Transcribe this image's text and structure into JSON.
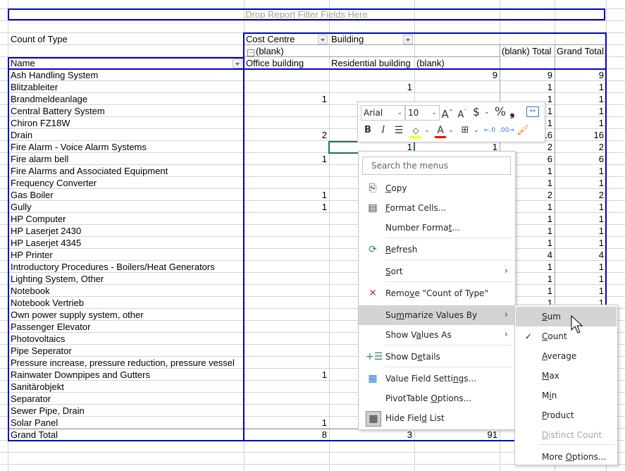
{
  "pivot": {
    "report_filter_placeholder": "Drop Report Filter Fields Here",
    "values_label": "Count of Type",
    "column_fields": [
      "Cost Centre",
      "Building"
    ],
    "col_group_label": "(blank)",
    "row_field": "Name",
    "column_headers": [
      "Office building",
      "Residential building",
      "(blank)",
      "(blank) Total",
      "Grand Total"
    ],
    "rows": [
      {
        "name": "Ash Handling System",
        "office": "",
        "residential": "",
        "blank": "9",
        "blank_total": "9",
        "grand_total": "9"
      },
      {
        "name": "Blitzableiter",
        "office": "",
        "residential": "1",
        "blank": "",
        "blank_total": "1",
        "grand_total": "1"
      },
      {
        "name": "Brandmeldeanlage",
        "office": "1",
        "residential": "",
        "blank": "",
        "blank_total": "1",
        "grand_total": "1"
      },
      {
        "name": "Central Battery System",
        "office": "",
        "residential": "",
        "blank": "",
        "blank_total": "1",
        "grand_total": "1"
      },
      {
        "name": "Chiron FZ18W",
        "office": "",
        "residential": "",
        "blank": "",
        "blank_total": "1",
        "grand_total": "1"
      },
      {
        "name": "Drain",
        "office": "2",
        "residential": "",
        "blank": "",
        "blank_total": "16",
        "grand_total": "16"
      },
      {
        "name": "Fire Alarm - Voice Alarm Systems",
        "office": "",
        "residential": "1",
        "blank": "1",
        "blank_total": "2",
        "grand_total": "2"
      },
      {
        "name": "Fire alarm bell",
        "office": "1",
        "residential": "",
        "blank": "",
        "blank_total": "6",
        "grand_total": "6"
      },
      {
        "name": "Fire Alarms and Associated Equipment",
        "office": "",
        "residential": "",
        "blank": "",
        "blank_total": "1",
        "grand_total": "1"
      },
      {
        "name": "Frequency Converter",
        "office": "",
        "residential": "",
        "blank": "",
        "blank_total": "1",
        "grand_total": "1"
      },
      {
        "name": "Gas Boiler",
        "office": "1",
        "residential": "",
        "blank": "",
        "blank_total": "2",
        "grand_total": "2"
      },
      {
        "name": "Gully",
        "office": "1",
        "residential": "",
        "blank": "",
        "blank_total": "1",
        "grand_total": "1"
      },
      {
        "name": "HP Computer",
        "office": "",
        "residential": "",
        "blank": "",
        "blank_total": "1",
        "grand_total": "1"
      },
      {
        "name": "HP Laserjet 2430",
        "office": "",
        "residential": "",
        "blank": "",
        "blank_total": "1",
        "grand_total": "1"
      },
      {
        "name": "HP Laserjet 4345",
        "office": "",
        "residential": "",
        "blank": "",
        "blank_total": "1",
        "grand_total": "1"
      },
      {
        "name": "HP Printer",
        "office": "",
        "residential": "",
        "blank": "",
        "blank_total": "4",
        "grand_total": "4"
      },
      {
        "name": "Introductory Procedures - Boilers/Heat Generators",
        "office": "",
        "residential": "",
        "blank": "",
        "blank_total": "1",
        "grand_total": "1"
      },
      {
        "name": "Lighting System, Other",
        "office": "",
        "residential": "",
        "blank": "",
        "blank_total": "1",
        "grand_total": "1"
      },
      {
        "name": "Notebook",
        "office": "",
        "residential": "",
        "blank": "",
        "blank_total": "1",
        "grand_total": "1"
      },
      {
        "name": "Notebook Vertrieb",
        "office": "",
        "residential": "",
        "blank": "",
        "blank_total": "1",
        "grand_total": "1"
      },
      {
        "name": "Own power supply system, other",
        "office": "",
        "residential": "",
        "blank": "",
        "blank_total": "",
        "grand_total": ""
      },
      {
        "name": "Passenger Elevator",
        "office": "",
        "residential": "",
        "blank": "",
        "blank_total": "",
        "grand_total": ""
      },
      {
        "name": "Photovoltaics",
        "office": "",
        "residential": "",
        "blank": "",
        "blank_total": "",
        "grand_total": ""
      },
      {
        "name": "Pipe Seperator",
        "office": "",
        "residential": "",
        "blank": "",
        "blank_total": "",
        "grand_total": ""
      },
      {
        "name": "Pressure increase, pressure reduction, pressure vessel",
        "office": "",
        "residential": "",
        "blank": "",
        "blank_total": "",
        "grand_total": ""
      },
      {
        "name": "Rainwater Downpipes and Gutters",
        "office": "1",
        "residential": "",
        "blank": "",
        "blank_total": "",
        "grand_total": ""
      },
      {
        "name": "Sanitärobjekt",
        "office": "",
        "residential": "",
        "blank": "",
        "blank_total": "",
        "grand_total": ""
      },
      {
        "name": "Separator",
        "office": "",
        "residential": "",
        "blank": "",
        "blank_total": "",
        "grand_total": ""
      },
      {
        "name": "Sewer Pipe, Drain",
        "office": "",
        "residential": "",
        "blank": "",
        "blank_total": "",
        "grand_total": ""
      },
      {
        "name": "Solar Panel",
        "office": "1",
        "residential": "",
        "blank": "",
        "blank_total": "",
        "grand_total": ""
      }
    ],
    "grand_total": {
      "name": "Grand Total",
      "office": "8",
      "residential": "3",
      "blank": "91",
      "blank_total": "",
      "grand_total": ""
    }
  },
  "mini_toolbar": {
    "font_name": "Arial",
    "font_size": "10",
    "increase_font_icon": "A^",
    "decrease_font_icon": "Aˇ",
    "currency_icon": "$",
    "percent_icon": "%",
    "comma_icon": "❟",
    "bold": "B",
    "italic": "I",
    "fill_color": "#ffff00",
    "font_color": "#ff0000"
  },
  "context_menu": {
    "search_placeholder": "Search the menus",
    "items": [
      {
        "label_pre": "",
        "label_u": "C",
        "label_post": "opy"
      },
      {
        "label_pre": "",
        "label_u": "F",
        "label_post": "ormat Cells..."
      },
      {
        "label_pre": "Number Forma",
        "label_u": "t",
        "label_post": "..."
      },
      {
        "label_pre": "",
        "label_u": "R",
        "label_post": "efresh"
      },
      {
        "label_pre": "",
        "label_u": "S",
        "label_post": "ort"
      },
      {
        "label_pre": "Remo",
        "label_u": "v",
        "label_post": "e \"Count of Type\""
      },
      {
        "label_pre": "Su",
        "label_u": "m",
        "label_post": "marize Values By"
      },
      {
        "label_pre": "Show V",
        "label_u": "a",
        "label_post": "lues As"
      },
      {
        "label_pre": "Show D",
        "label_u": "e",
        "label_post": "tails"
      },
      {
        "label_pre": "Value Field Setti",
        "label_u": "n",
        "label_post": "gs..."
      },
      {
        "label_pre": "PivotTable ",
        "label_u": "O",
        "label_post": "ptions..."
      },
      {
        "label_pre": "Hide Fiel",
        "label_u": "d",
        "label_post": " List"
      }
    ]
  },
  "submenu": {
    "items": [
      {
        "label_pre": "",
        "label_u": "S",
        "label_post": "um",
        "checked": false,
        "disabled": false
      },
      {
        "label_pre": "",
        "label_u": "C",
        "label_post": "ount",
        "checked": true,
        "disabled": false
      },
      {
        "label_pre": "",
        "label_u": "A",
        "label_post": "verage",
        "checked": false,
        "disabled": false
      },
      {
        "label_pre": "",
        "label_u": "M",
        "label_post": "ax",
        "checked": false,
        "disabled": false
      },
      {
        "label_pre": "M",
        "label_u": "i",
        "label_post": "n",
        "checked": false,
        "disabled": false
      },
      {
        "label_pre": "",
        "label_u": "P",
        "label_post": "roduct",
        "checked": false,
        "disabled": false
      },
      {
        "label_pre": "",
        "label_u": "D",
        "label_post": "istinct Count",
        "checked": false,
        "disabled": true
      },
      {
        "label_pre": "More ",
        "label_u": "O",
        "label_post": "ptions...",
        "checked": false,
        "disabled": false
      }
    ],
    "check_mark": "✓"
  }
}
